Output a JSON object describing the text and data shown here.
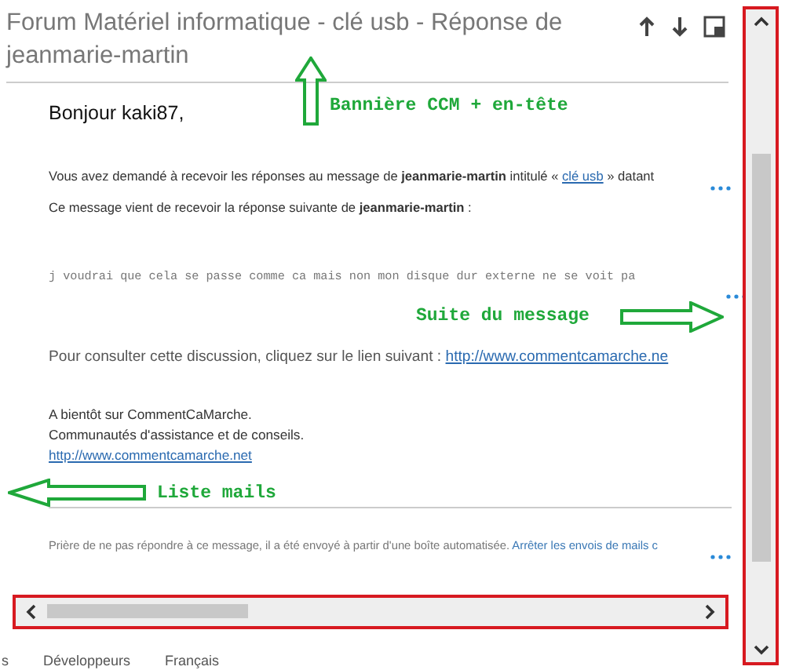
{
  "message": {
    "title": "Forum Matériel informatique - clé usb - Réponse de jeanmarie-martin",
    "greeting": "Bonjour kaki87,",
    "intro": {
      "before": "Vous avez demandé à recevoir les réponses au message de **jeanmarie-martin** intitulé « ",
      "link": "clé usb",
      "after": " » datant"
    },
    "notice": "Ce message vient de recevoir la réponse suivante de **jeanmarie-martin** :",
    "reply_excerpt": "j voudrai que cela se passe comme ca mais non mon disque dur externe ne se voit pa",
    "consult": {
      "text": "Pour consulter cette discussion, cliquez sur le lien suivant : ",
      "link": "http://www.commentcamarche.ne"
    },
    "signature": [
      "A bientôt sur CommentCaMarche.",
      "Communautés d'assistance et de conseils."
    ],
    "signature_link": "http://www.commentcamarche.net",
    "disclaimer": {
      "text": "Prière de ne pas répondre à ce message, il a été envoyé à partir d'une boîte automatisée. ",
      "link": "Arrêter les envois de mails c"
    }
  },
  "annotations": [
    {
      "kind": "up",
      "label": "Bannière CCM + en-tête"
    },
    {
      "kind": "right",
      "label": "Suite du message"
    },
    {
      "kind": "left",
      "label": "Liste mails"
    }
  ],
  "footer_links": [
    "s",
    "Développeurs",
    "Français"
  ]
}
